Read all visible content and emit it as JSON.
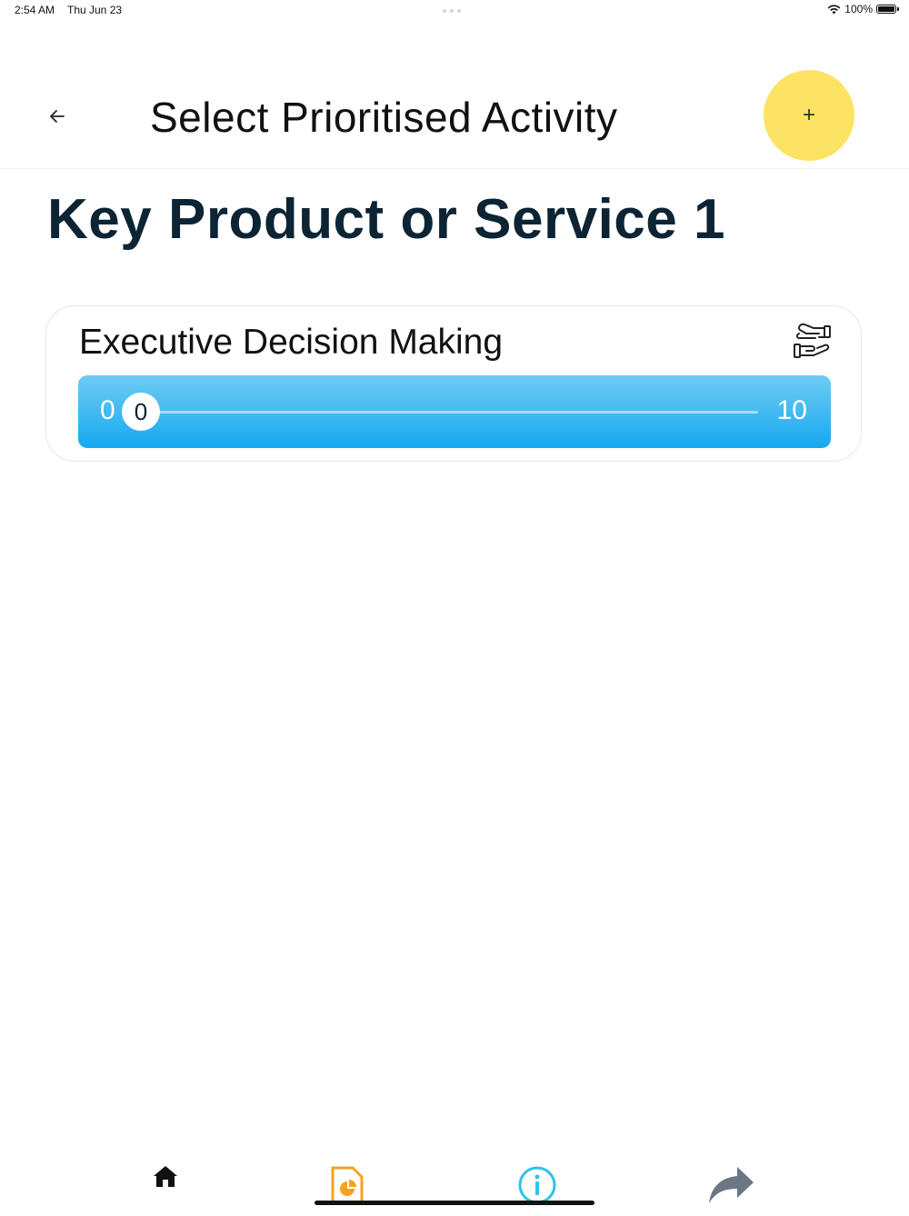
{
  "status_bar": {
    "time": "2:54 AM",
    "date": "Thu Jun 23",
    "battery": "100%",
    "wifi_icon": "wifi-icon",
    "battery_icon": "battery-icon"
  },
  "header": {
    "title": "Select Prioritised Activity",
    "back_icon": "arrow-left-icon",
    "add_label": "+",
    "add_color": "#fce363"
  },
  "section": {
    "title": "Key Product or Service 1"
  },
  "card": {
    "title": "Executive Decision Making",
    "icon": "handshake-icon",
    "slider": {
      "min": "0",
      "max": "10",
      "value": "0",
      "gradient_top": "#6fccf4",
      "gradient_bottom": "#16a8f0"
    }
  },
  "bottom_nav": {
    "items": [
      {
        "icon": "home-icon",
        "color": "#111111"
      },
      {
        "icon": "report-icon",
        "color": "#f7a21b"
      },
      {
        "icon": "info-icon",
        "color": "#2ec4e9"
      },
      {
        "icon": "share-icon",
        "color": "#6b7785"
      }
    ]
  }
}
